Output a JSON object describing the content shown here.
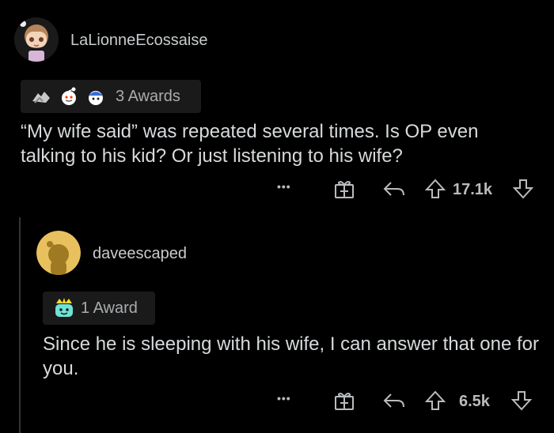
{
  "comment1": {
    "username": "LaLionneEcossaise",
    "awards_label": "3 Awards",
    "text": "“My wife said” was repeated several times. Is OP even talking to his kid? Or just listening to his wife?",
    "more_label": "•••",
    "score": "17.1k"
  },
  "comment2": {
    "username": "daveescaped",
    "awards_label": "1 Award",
    "text": "Since he is sleeping with his wife, I can answer that one for you.",
    "more_label": "•••",
    "score": "6.5k"
  },
  "colors": {
    "background": "#000000",
    "text": "#d7dadc",
    "muted": "#b9bcbe",
    "snoo_avatar": "#e8c15e"
  },
  "icons": [
    "award-hands-icon",
    "award-snoo-icon",
    "award-helmet-icon",
    "award-wholesome-icon",
    "gift-icon",
    "reply-icon",
    "upvote-icon",
    "downvote-icon"
  ]
}
